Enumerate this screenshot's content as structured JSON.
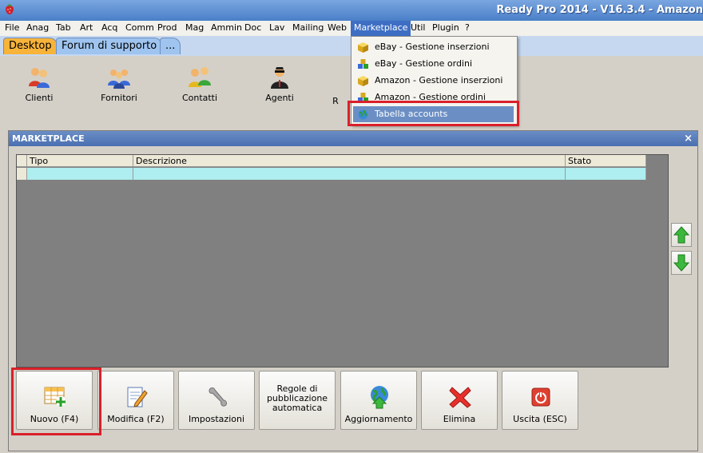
{
  "window": {
    "title": "Ready Pro 2014 - V16.3.4 - Amazon"
  },
  "menubar": {
    "items": [
      "File",
      "Anag",
      "Tab",
      "Art",
      "Acq",
      "Comm",
      "Prod",
      "Mag",
      "Ammin",
      "Doc",
      "Lav",
      "Mailing",
      "Web",
      "Marketplace",
      "Util",
      "Plugin",
      "?"
    ]
  },
  "tabs": [
    {
      "label": "Desktop",
      "selected": true
    },
    {
      "label": "Forum di supporto",
      "selected": false
    },
    {
      "label": "...",
      "selected": false
    }
  ],
  "desktop_icons": [
    {
      "label": "Clienti",
      "icon": "clients-icon"
    },
    {
      "label": "Fornitori",
      "icon": "suppliers-icon"
    },
    {
      "label": "Contatti",
      "icon": "contacts-icon"
    },
    {
      "label": "Agenti",
      "icon": "agents-icon"
    },
    {
      "label": "R",
      "icon": "partial-icon"
    }
  ],
  "marketplace_menu": {
    "items": [
      {
        "label": "eBay - Gestione inserzioni",
        "icon": "box-icon"
      },
      {
        "label": "eBay - Gestione ordini",
        "icon": "orders-icon"
      },
      {
        "label": "Amazon - Gestione inserzioni",
        "icon": "box-icon"
      },
      {
        "label": "Amazon - Gestione ordini",
        "icon": "orders-icon"
      },
      {
        "label": "Tabella accounts",
        "icon": "accounts-icon",
        "highlighted": true
      }
    ]
  },
  "dialog": {
    "title": "MARKETPLACE",
    "close_label": "×",
    "grid": {
      "columns": [
        "Tipo",
        "Descrizione",
        "Stato"
      ]
    },
    "buttons": [
      {
        "label": "Nuovo (F4)",
        "icon": "new-table-icon"
      },
      {
        "label": "Modifica (F2)",
        "icon": "edit-icon"
      },
      {
        "label": "Impostazioni",
        "icon": "wrench-icon"
      },
      {
        "label": "Regole di pubblicazione automatica",
        "icon": ""
      },
      {
        "label": "Aggiornamento",
        "icon": "globe-update-icon"
      },
      {
        "label": "Elimina",
        "icon": "delete-x-icon"
      },
      {
        "label": "Uscita (ESC)",
        "icon": "power-icon"
      }
    ]
  },
  "colors": {
    "highlight_red": "#d9202a",
    "selected_tab": "#f7b33a",
    "grid_row": "#aeeef0"
  }
}
